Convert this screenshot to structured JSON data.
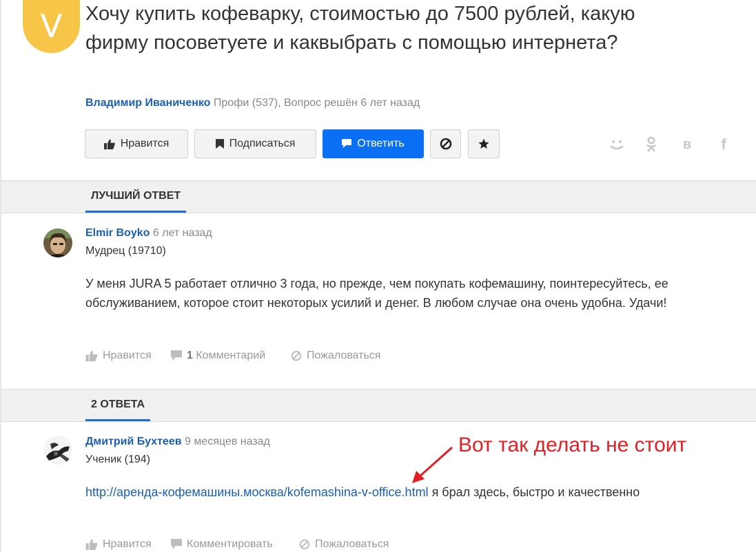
{
  "question": {
    "avatar_letter": "V",
    "title": "Хочу купить кофеварку, стоимостью до 7500 рублей, какую фирму посоветуете и каквыбрать с помощью интернета?",
    "author": "Владимир Иваниченко",
    "meta": "Профи (537), Вопрос решён 6 лет назад",
    "buttons": {
      "like": "Нравится",
      "subscribe": "Подписаться",
      "reply": "Ответить"
    },
    "share_icons": [
      "mailru-icon",
      "odnoklassniki-icon",
      "vk-icon",
      "facebook-icon"
    ],
    "share_vk_glyph": "в",
    "share_fb_glyph": "f"
  },
  "best_answer": {
    "section_title": "ЛУЧШИЙ ОТВЕТ",
    "author": "Elmir Boyko",
    "time": "6 лет назад",
    "rank": "Мудрец (19710)",
    "text": "У меня JURA 5 работает отлично 3 года, но прежде, чем покупать кофемашину, поинтересуйтесь, ее обслуживанием, которое стоит некоторых усилий и денег. В любом случае она очень удобна. Удачи!",
    "actions": {
      "like": "Нравится",
      "comments_count": "1",
      "comments_label": "Комментарий",
      "report": "Пожаловаться"
    }
  },
  "answers": {
    "section_title": "2 ОТВЕТА",
    "items": [
      {
        "author": "Дмитрий Бухтеев",
        "time": "9 месяцев назад",
        "rank": "Ученик (194)",
        "link": "http://аренда-кофемашины.москва/kofemashina-v-office.html",
        "text_after_link": " я брал здесь, быстро и качественно",
        "actions": {
          "like": "Нравится",
          "comment": "Комментировать",
          "report": "Пожаловаться"
        }
      }
    ]
  },
  "annotation": {
    "text": "Вот так делать не стоит",
    "color": "#e31e24"
  },
  "colors": {
    "accent": "#0a6ff5",
    "link": "#1a5fb4",
    "avatar_bg": "#f7c548"
  }
}
